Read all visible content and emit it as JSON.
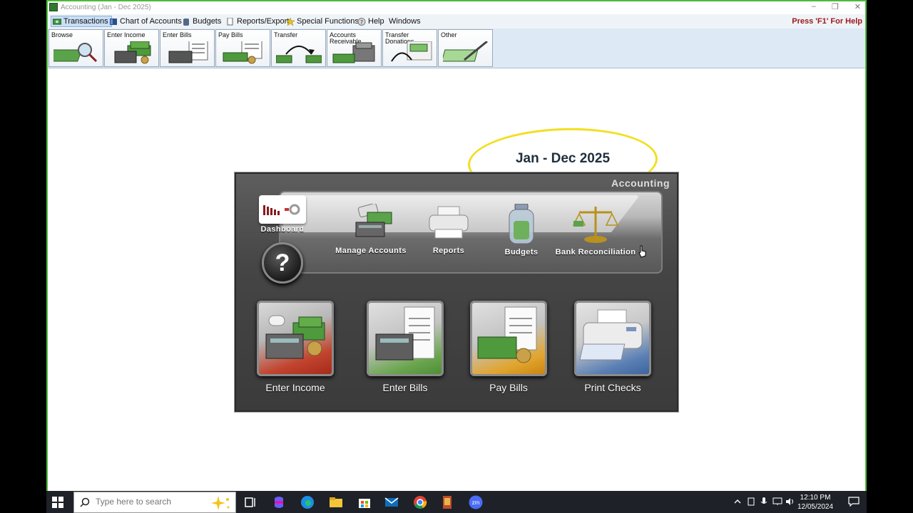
{
  "window": {
    "title": "Accounting (Jan - Dec 2025)",
    "controls": [
      "–",
      "❐",
      "✕"
    ]
  },
  "menu": {
    "items": [
      "Transactions",
      "Chart of Accounts",
      "Budgets",
      "Reports/Export",
      "Special Functions",
      "Help",
      "Windows"
    ],
    "help_hint": "Press 'F1' For Help"
  },
  "toolbar": {
    "buttons": [
      "Browse",
      "Enter Income",
      "Enter Bills",
      "Pay Bills",
      "Transfer",
      "Accounts Receivable",
      "Transfer Donations",
      "Other"
    ]
  },
  "header": {
    "period": "Jan - Dec 2025"
  },
  "panel": {
    "title": "Accounting",
    "dashboard": "Dashboard",
    "help_symbol": "?",
    "nav": [
      "Manage Accounts",
      "Reports",
      "Budgets",
      "Bank Reconciliation"
    ],
    "tiles": [
      "Enter Income",
      "Enter Bills",
      "Pay Bills",
      "Print Checks"
    ]
  },
  "taskbar": {
    "search_placeholder": "Type here to search",
    "time": "12:10 PM",
    "date": "12/05/2024"
  },
  "colors": {
    "accent_green": "#4dbb3a",
    "help_red": "#a01818",
    "highlight_yellow": "#f2df20"
  }
}
